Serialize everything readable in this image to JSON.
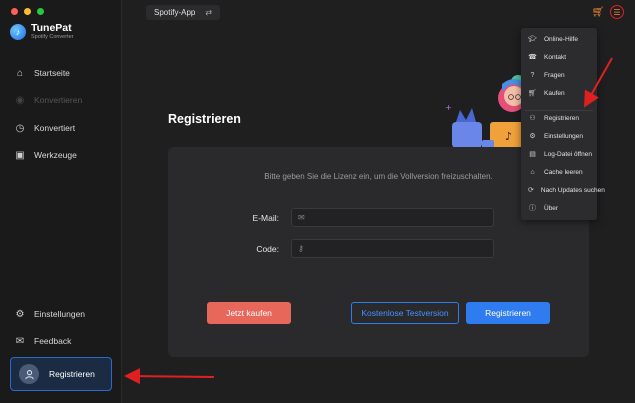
{
  "app": {
    "name": "TunePat",
    "subtitle": "Spotify Converter",
    "source": "Spotify-App"
  },
  "sidebar": {
    "items": [
      {
        "label": "Startseite",
        "icon": "home-icon"
      },
      {
        "label": "Konvertieren",
        "icon": "convert-icon"
      },
      {
        "label": "Konvertiert",
        "icon": "clock-icon"
      },
      {
        "label": "Werkzeuge",
        "icon": "toolbox-icon"
      },
      {
        "label": "Einstellungen",
        "icon": "gear-icon"
      },
      {
        "label": "Feedback",
        "icon": "mail-icon"
      }
    ],
    "register_label": "Registrieren"
  },
  "page": {
    "title": "Registrieren",
    "hint": "Bitte geben Sie die Lizenz ein, um die Vollversion freizuschalten.",
    "email_label": "E-Mail:",
    "code_label": "Code:",
    "email_value": "",
    "code_value": "",
    "buy_label": "Jetzt kaufen",
    "trial_label": "Kostenlose Testversion",
    "register_label": "Registrieren"
  },
  "menu": {
    "items": [
      {
        "label": "Online-Hilfe",
        "icon": "graduation-cap-icon"
      },
      {
        "label": "Kontakt",
        "icon": "phone-icon"
      },
      {
        "label": "Fragen",
        "icon": "question-icon"
      },
      {
        "label": "Kaufen",
        "icon": "cart-icon"
      },
      {
        "label": "Registrieren",
        "icon": "user-key-icon"
      },
      {
        "label": "Einstellungen",
        "icon": "gear-icon"
      },
      {
        "label": "Log-Datei öffnen",
        "icon": "file-icon"
      },
      {
        "label": "Cache leeren",
        "icon": "broom-icon"
      },
      {
        "label": "Nach Updates suchen",
        "icon": "refresh-icon"
      },
      {
        "label": "Über",
        "icon": "info-icon"
      }
    ]
  },
  "colors": {
    "accent": "#2f7bf0",
    "buy": "#e8675b",
    "annotation_arrow": "#e02020"
  }
}
